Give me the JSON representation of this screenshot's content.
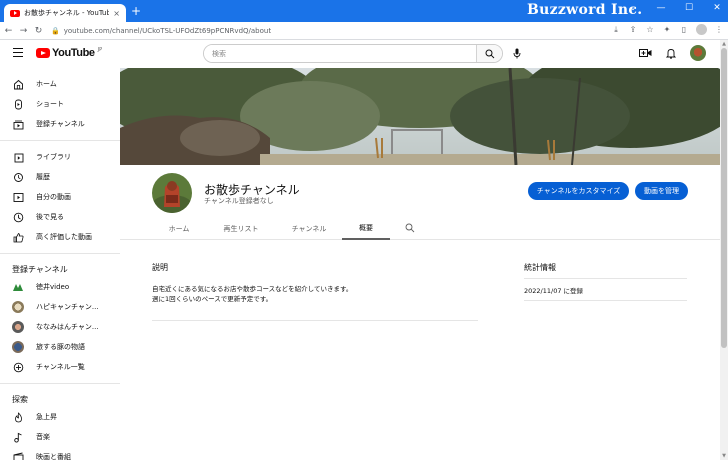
{
  "browser": {
    "tab_title": "お散歩チャンネル - YouTube",
    "tab_close": "×",
    "new_tab": "+",
    "url": "youtube.com/channel/UCkoTSL-UFOdZt69pPCNRvdQ/about",
    "watermark": "Buzzword Inc."
  },
  "header": {
    "logo_text": "YouTube",
    "logo_region": "JP",
    "search_placeholder": "検索"
  },
  "sidebar": {
    "main_items": [
      {
        "label": "ホーム",
        "icon": "home-icon"
      },
      {
        "label": "ショート",
        "icon": "shorts-icon"
      },
      {
        "label": "登録チャンネル",
        "icon": "subscriptions-icon"
      }
    ],
    "library_items": [
      {
        "label": "ライブラリ",
        "icon": "library-icon"
      },
      {
        "label": "履歴",
        "icon": "history-icon"
      },
      {
        "label": "自分の動画",
        "icon": "your-videos-icon"
      },
      {
        "label": "後で見る",
        "icon": "watch-later-icon"
      },
      {
        "label": "高く評価した動画",
        "icon": "liked-icon"
      }
    ],
    "subscriptions_heading": "登録チャンネル",
    "subscriptions": [
      {
        "label": "徳井video"
      },
      {
        "label": "ハピキャンチャン..."
      },
      {
        "label": "ななみはんチャン..."
      },
      {
        "label": "旅する豚の物語"
      },
      {
        "label": "チャンネル一覧"
      }
    ],
    "explore_heading": "探索",
    "explore_items": [
      {
        "label": "急上昇",
        "icon": "trending-icon"
      },
      {
        "label": "音楽",
        "icon": "music-icon"
      },
      {
        "label": "映画と番組",
        "icon": "movies-icon"
      }
    ]
  },
  "channel": {
    "name": "お散歩チャンネル",
    "subscribers": "チャンネル登録者なし",
    "customize_button": "チャンネルをカスタマイズ",
    "manage_button": "動画を管理",
    "tabs": [
      "ホーム",
      "再生リスト",
      "チャンネル",
      "概要"
    ],
    "active_tab": "概要"
  },
  "about": {
    "description_title": "説明",
    "description_line1": "自宅近くにある気になるお店や散歩コースなどを紹介していきます。",
    "description_line2": "週に1回くらいのペースで更新予定です。",
    "stats_title": "統計情報",
    "joined": "2022/11/07 に登録"
  },
  "colors": {
    "titlebar": "#1a73e8",
    "youtube_red": "#ff0000",
    "button_blue": "#065fd4"
  }
}
